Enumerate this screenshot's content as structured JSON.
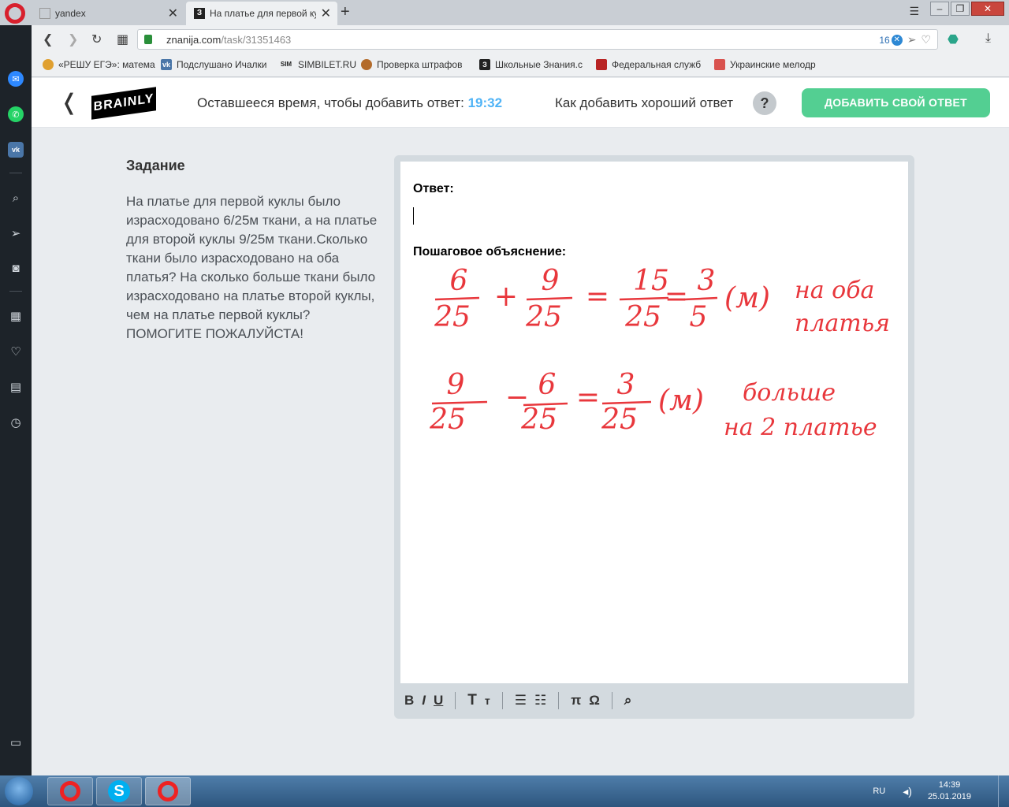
{
  "browser": {
    "tabs": [
      {
        "title": "yandex",
        "favicon": ""
      },
      {
        "title": "На платье для первой кук",
        "favicon": "З"
      }
    ],
    "url_domain": "znanija.com",
    "url_path": "/task/31351463",
    "adblock_count": "16",
    "bookmarks": [
      {
        "label": "«РЕШУ ЕГЭ»: матема",
        "icon": "reshu-icon",
        "color": "#e0a030",
        "glyph": ""
      },
      {
        "label": "Подслушано Ичалки",
        "icon": "vk-icon",
        "color": "#4a76a8",
        "glyph": "vk"
      },
      {
        "label": "SIMBILET.RU",
        "icon": "sim-icon",
        "color": "#222",
        "glyph": "SIM"
      },
      {
        "label": "Проверка штрафов",
        "icon": "emblem-icon",
        "color": "#b36b2b",
        "glyph": ""
      },
      {
        "label": "Школьные Знания.с",
        "icon": "znanija-icon",
        "color": "#222",
        "glyph": "З"
      },
      {
        "label": "Федеральная служб",
        "icon": "fed-icon",
        "color": "#b82424",
        "glyph": ""
      },
      {
        "label": "Украинские мелодр",
        "icon": "ukr-icon",
        "color": "#d9534f",
        "glyph": ""
      }
    ]
  },
  "header": {
    "logo": "BRAINLY",
    "timer_label": "Оставшееся время, чтобы добавить ответ:",
    "timer_value": "19:32",
    "howto_label": "Как добавить хороший ответ",
    "help": "?",
    "add_button": "ДОБАВИТЬ СВОЙ ОТВЕТ"
  },
  "task": {
    "heading": "Задание",
    "text": "На платье для первой куклы было израсходовано 6/25м ткани, а на платье для второй куклы 9/25м ткани.Сколько ткани было израсходовано на оба платья? На сколько больше ткани было израсходовано на платье второй куклы, чем на платье первой куклы? ПОМОГИТЕ ПОЖАЛУЙСТА!"
  },
  "editor": {
    "answer_label": "Ответ:",
    "explanation_label": "Пошаговое объяснение:",
    "handwriting": {
      "line1": {
        "n1": "6",
        "d1": "25",
        "op": "+",
        "n2": "9",
        "d2": "25",
        "eq": "=",
        "n3": "15",
        "d3": "25",
        "eq2": "=",
        "n4": "3",
        "d4": "5",
        "unit": "(м)",
        "note1": "на оба",
        "note2": "платья"
      },
      "line2": {
        "n1": "9",
        "d1": "25",
        "op": "−",
        "n2": "6",
        "d2": "25",
        "eq": "=",
        "n3": "3",
        "d3": "25",
        "unit": "(м)",
        "note1": "больше",
        "note2": "на 2 платье"
      }
    },
    "toolbar": [
      "B",
      "I",
      "U",
      "T",
      "т",
      "pi",
      "Ω"
    ]
  },
  "taskbar": {
    "lang": "RU",
    "time": "14:39",
    "date": "25.01.2019"
  },
  "colors": {
    "brand_green": "#53cf92",
    "timer_blue": "#4fb3f6",
    "ink_red": "#e8373c"
  }
}
